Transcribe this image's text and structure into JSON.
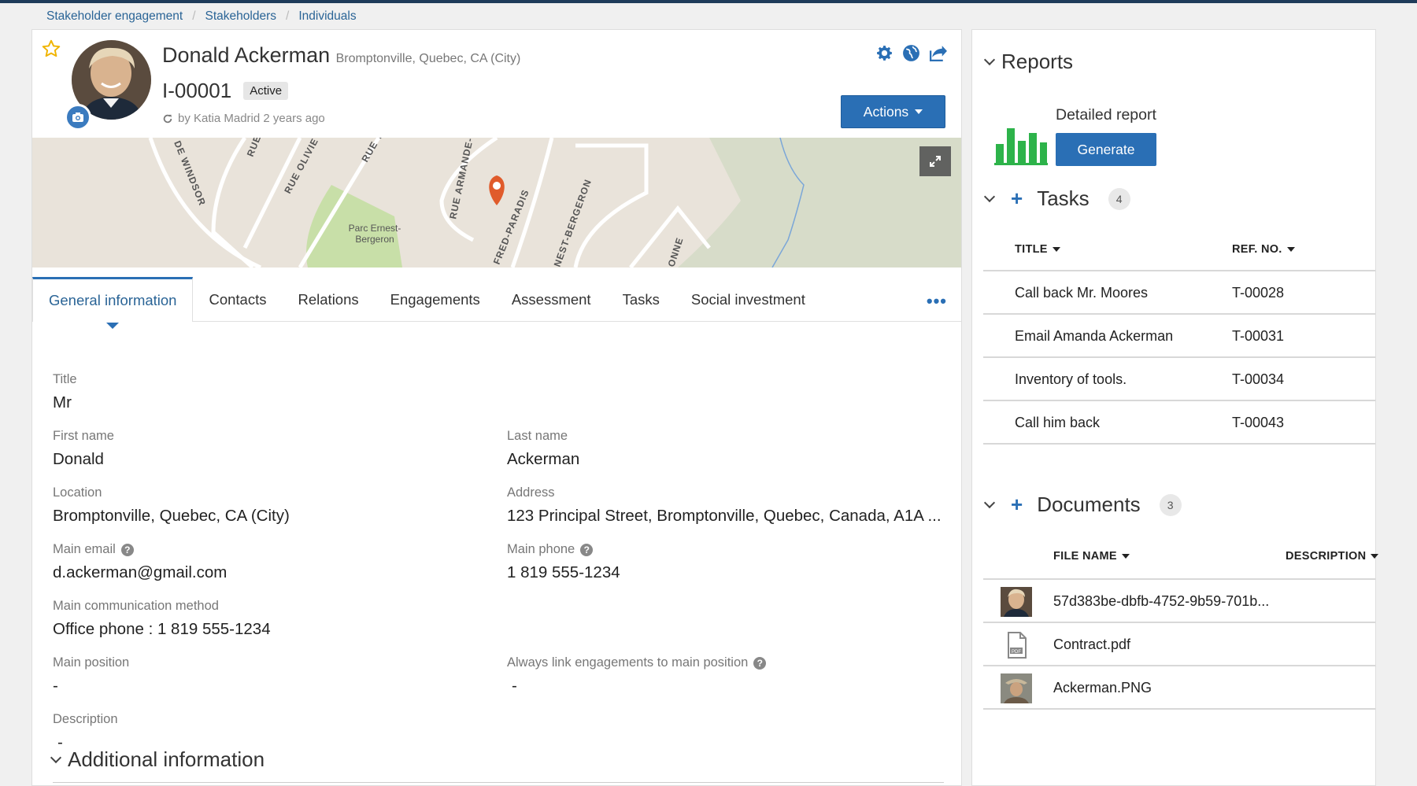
{
  "breadcrumb": {
    "items": [
      "Stakeholder engagement",
      "Stakeholders",
      "Individuals"
    ]
  },
  "profile": {
    "name": "Donald Ackerman",
    "location_suffix": "Bromptonville, Quebec, CA (City)",
    "id": "I-00001",
    "status": "Active",
    "byline": "by Katia Madrid 2 years ago",
    "actions_label": "Actions"
  },
  "map": {
    "labels": [
      "DE WINDSOR",
      "RUE",
      "RUE OLIVIE",
      "RUE T",
      "RUE ARMANDE-E",
      "FRED-PARADIS",
      "NEST-BERGERON",
      "ONNE",
      "Parc Ernest-",
      "Bergeron"
    ]
  },
  "tabs": [
    "General information",
    "Contacts",
    "Relations",
    "Engagements",
    "Assessment",
    "Tasks",
    "Social investment"
  ],
  "fields": {
    "title": {
      "label": "Title",
      "value": "Mr"
    },
    "first_name": {
      "label": "First name",
      "value": "Donald"
    },
    "last_name": {
      "label": "Last name",
      "value": "Ackerman"
    },
    "location": {
      "label": "Location",
      "value": "Bromptonville, Quebec, CA (City)"
    },
    "address": {
      "label": "Address",
      "value": "123 Principal Street, Bromptonville, Quebec, Canada, A1A ..."
    },
    "main_email": {
      "label": "Main email",
      "value": "d.ackerman@gmail.com"
    },
    "main_phone": {
      "label": "Main phone",
      "value": "1 819 555-1234"
    },
    "main_comm": {
      "label": "Main communication method",
      "value": "Office phone : 1 819 555-1234"
    },
    "main_position": {
      "label": "Main position",
      "value": "-"
    },
    "always_link": {
      "label": "Always link engagements to main position",
      "value": "-"
    },
    "description": {
      "label": "Description",
      "value": "-"
    }
  },
  "additional": {
    "title": "Additional information"
  },
  "reports": {
    "title": "Reports",
    "item_name": "Detailed report",
    "generate_label": "Generate"
  },
  "tasks": {
    "title": "Tasks",
    "count": "4",
    "headers": {
      "title": "TITLE",
      "ref": "REF. NO."
    },
    "rows": [
      {
        "title": "Call back Mr. Moores",
        "ref": "T-00028"
      },
      {
        "title": "Email Amanda Ackerman",
        "ref": "T-00031"
      },
      {
        "title": "Inventory of tools.",
        "ref": "T-00034"
      },
      {
        "title": "Call him back",
        "ref": "T-00043"
      }
    ]
  },
  "documents": {
    "title": "Documents",
    "count": "3",
    "headers": {
      "file": "FILE NAME",
      "description": "DESCRIPTION"
    },
    "rows": [
      {
        "file": "57d383be-dbfb-4752-9b59-701b...",
        "icon": "photo-thumbnail-icon"
      },
      {
        "file": "Contract.pdf",
        "icon": "pdf-file-icon"
      },
      {
        "file": "Ackerman.PNG",
        "icon": "photo-thumbnail-icon"
      }
    ]
  },
  "colors": {
    "accent": "#2a6fb5",
    "link": "#2a6496",
    "report_green": "#2db34a",
    "map_park": "#c8dfa8"
  }
}
